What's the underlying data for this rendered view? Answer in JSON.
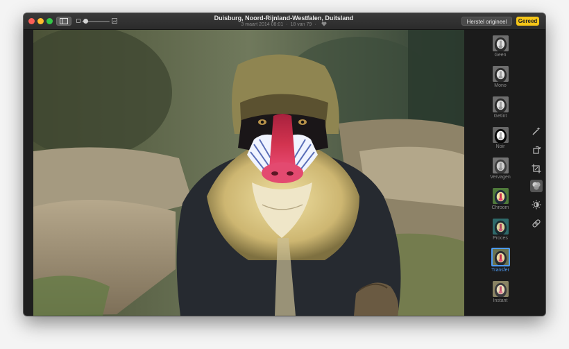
{
  "window": {
    "title": "Duisburg, Noord-Rijnland-Westfalen, Duitsland",
    "date": "3 maart 2014 08:01",
    "counter": "18 van 79",
    "revert_label": "Herstel origineel",
    "done_label": "Gereed",
    "accent_color": "#f5c518"
  },
  "toolbar": {
    "zoom_level": 0.1,
    "icons": [
      "sidebar-icon",
      "small-photo-icon",
      "large-photo-icon",
      "heart-icon"
    ]
  },
  "filters": [
    {
      "label": "Geen",
      "tint": "none"
    },
    {
      "label": "Mono",
      "tint": "mono"
    },
    {
      "label": "Getint",
      "tint": "tonal"
    },
    {
      "label": "Noir",
      "tint": "noir"
    },
    {
      "label": "Vervagen",
      "tint": "fade"
    },
    {
      "label": "Chroom",
      "tint": "chrome"
    },
    {
      "label": "Proces",
      "tint": "process"
    },
    {
      "label": "Transfer",
      "tint": "transfer",
      "selected": true
    },
    {
      "label": "Instant",
      "tint": "instant"
    }
  ],
  "tools": [
    {
      "name": "enhance",
      "icon": "magic-wand-icon"
    },
    {
      "name": "rotate",
      "icon": "rotate-icon"
    },
    {
      "name": "crop",
      "icon": "crop-icon"
    },
    {
      "name": "filters",
      "icon": "filters-icon",
      "active": true
    },
    {
      "name": "adjust",
      "icon": "adjust-icon"
    },
    {
      "name": "retouch",
      "icon": "bandage-icon"
    }
  ],
  "selection_color": "#4e9bf5"
}
